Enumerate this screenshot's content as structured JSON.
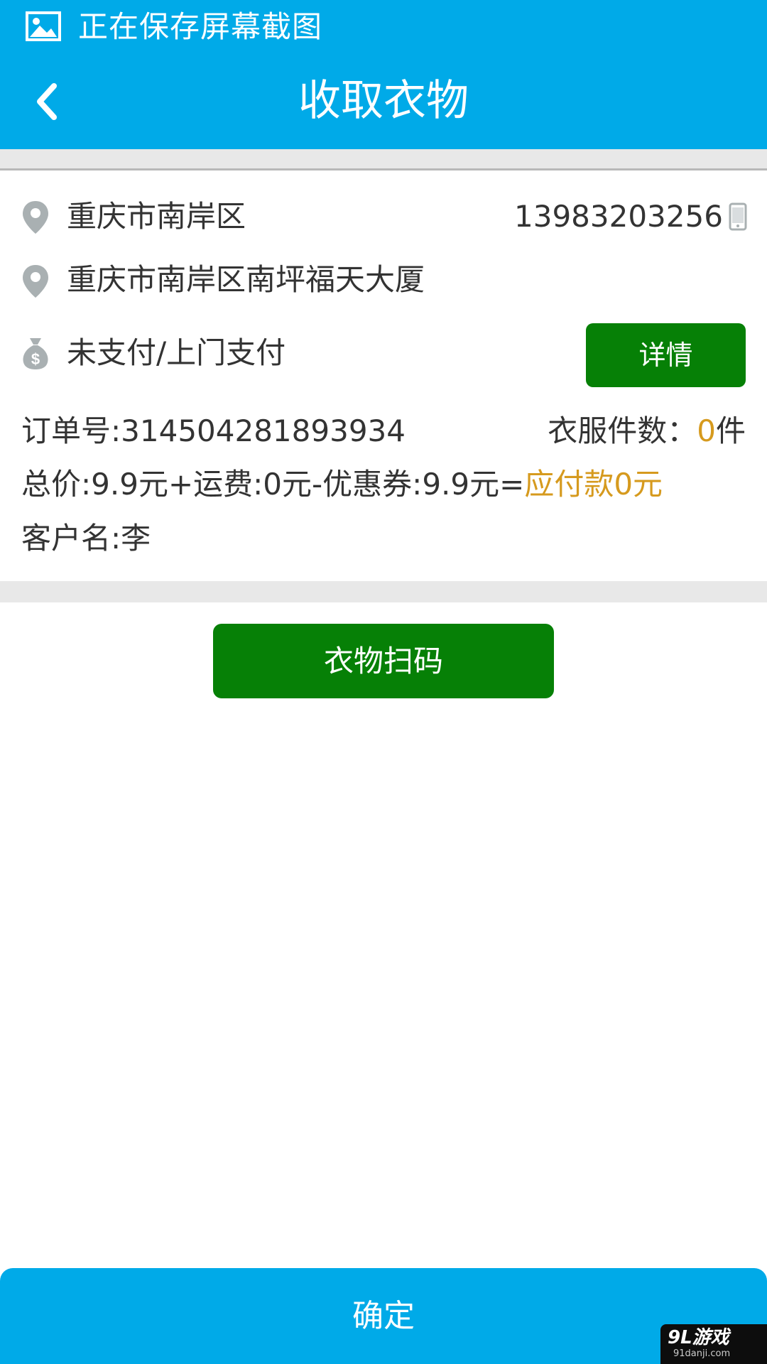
{
  "status_bar": {
    "icon": "image-icon",
    "text": "正在保存屏幕截图"
  },
  "header": {
    "back_icon": "chevron-left-icon",
    "title": "收取衣物"
  },
  "order": {
    "district": "重庆市南岸区",
    "phone": "13983203256",
    "address": "重庆市南岸区南坪福天大厦",
    "payment_status": "未支付/上门支付",
    "detail_button": "详情",
    "order_number_label": "订单号:",
    "order_number": "314504281893934",
    "clothes_count_label": "衣服件数：",
    "clothes_count": "0",
    "clothes_count_unit": "件",
    "price_formula": "总价:9.9元+运费:0元-优惠券:9.9元=",
    "amount_due": "应付款0元",
    "customer_label": "客户名:",
    "customer_name": "李"
  },
  "actions": {
    "scan_button": "衣物扫码",
    "confirm_button": "确定"
  },
  "watermark": {
    "main": "9L游戏",
    "sub": "91danji.com"
  },
  "colors": {
    "primary_blue": "#00aae8",
    "button_green": "#068006",
    "highlight_orange": "#d69a1e",
    "band_gray": "#e8e8e8"
  }
}
